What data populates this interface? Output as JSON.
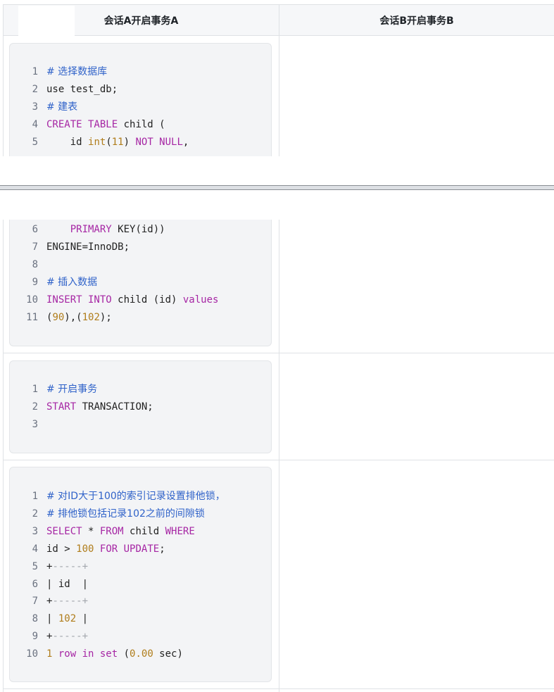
{
  "table": {
    "headers": [
      "会话A开启事务A",
      "会话B开启事务B"
    ]
  },
  "blocks": [
    {
      "lines": [
        {
          "n": "1",
          "parts": [
            {
              "t": "# 选择数据库",
              "c": "c"
            }
          ]
        },
        {
          "n": "2",
          "parts": [
            {
              "t": "use test_db;",
              "c": ""
            }
          ]
        },
        {
          "n": "3",
          "parts": [
            {
              "t": "# 建表",
              "c": "c"
            }
          ]
        },
        {
          "n": "4",
          "parts": [
            {
              "t": "CREATE TABLE",
              "c": "k"
            },
            {
              "t": " child (",
              "c": ""
            }
          ]
        },
        {
          "n": "5",
          "parts": [
            {
              "t": "    id ",
              "c": ""
            },
            {
              "t": "int",
              "c": "n"
            },
            {
              "t": "(",
              "c": ""
            },
            {
              "t": "11",
              "c": "n"
            },
            {
              "t": ") ",
              "c": ""
            },
            {
              "t": "NOT NULL",
              "c": "k"
            },
            {
              "t": ",",
              "c": ""
            }
          ]
        }
      ]
    },
    {
      "lines": [
        {
          "n": "6",
          "parts": [
            {
              "t": "    ",
              "c": ""
            },
            {
              "t": "PRIMARY",
              "c": "k"
            },
            {
              "t": " KEY(id))",
              "c": ""
            }
          ]
        },
        {
          "n": "7",
          "parts": [
            {
              "t": "ENGINE=InnoDB;",
              "c": ""
            }
          ]
        },
        {
          "n": "8",
          "parts": [
            {
              "t": "",
              "c": ""
            }
          ]
        },
        {
          "n": "9",
          "parts": [
            {
              "t": "# 插入数据",
              "c": "c"
            }
          ]
        },
        {
          "n": "10",
          "parts": [
            {
              "t": "INSERT INTO",
              "c": "k"
            },
            {
              "t": " child (id) ",
              "c": ""
            },
            {
              "t": "values",
              "c": "k"
            }
          ]
        },
        {
          "n": "11",
          "parts": [
            {
              "t": "(",
              "c": ""
            },
            {
              "t": "90",
              "c": "n"
            },
            {
              "t": "),(",
              "c": ""
            },
            {
              "t": "102",
              "c": "n"
            },
            {
              "t": ");",
              "c": ""
            }
          ]
        }
      ]
    },
    {
      "lines": [
        {
          "n": "1",
          "parts": [
            {
              "t": "# 开启事务",
              "c": "c"
            }
          ]
        },
        {
          "n": "2",
          "parts": [
            {
              "t": "START",
              "c": "k"
            },
            {
              "t": " TRANSACTION;",
              "c": ""
            }
          ]
        },
        {
          "n": "3",
          "parts": [
            {
              "t": "",
              "c": ""
            }
          ]
        }
      ]
    },
    {
      "lines": [
        {
          "n": "1",
          "parts": [
            {
              "t": "# 对ID大于100的索引记录设置排他锁，",
              "c": "c"
            }
          ]
        },
        {
          "n": "2",
          "parts": [
            {
              "t": "# 排他锁包括记录102之前的间隙锁",
              "c": "c"
            }
          ]
        },
        {
          "n": "3",
          "parts": [
            {
              "t": "SELECT",
              "c": "k"
            },
            {
              "t": " * ",
              "c": ""
            },
            {
              "t": "FROM",
              "c": "k"
            },
            {
              "t": " child ",
              "c": ""
            },
            {
              "t": "WHERE",
              "c": "k"
            }
          ]
        },
        {
          "n": "4",
          "parts": [
            {
              "t": "id > ",
              "c": ""
            },
            {
              "t": "100",
              "c": "n"
            },
            {
              "t": " ",
              "c": ""
            },
            {
              "t": "FOR UPDATE",
              "c": "k"
            },
            {
              "t": ";",
              "c": ""
            }
          ]
        },
        {
          "n": "5",
          "parts": [
            {
              "t": "+",
              "c": ""
            },
            {
              "t": "-----+",
              "c": "d"
            }
          ]
        },
        {
          "n": "6",
          "parts": [
            {
              "t": "| id  |",
              "c": ""
            }
          ]
        },
        {
          "n": "7",
          "parts": [
            {
              "t": "+",
              "c": ""
            },
            {
              "t": "-----+",
              "c": "d"
            }
          ]
        },
        {
          "n": "8",
          "parts": [
            {
              "t": "| ",
              "c": ""
            },
            {
              "t": "102",
              "c": "n"
            },
            {
              "t": " |",
              "c": ""
            }
          ]
        },
        {
          "n": "9",
          "parts": [
            {
              "t": "+",
              "c": ""
            },
            {
              "t": "-----+",
              "c": "d"
            }
          ]
        },
        {
          "n": "10",
          "parts": [
            {
              "t": "1",
              "c": "n"
            },
            {
              "t": " ",
              "c": ""
            },
            {
              "t": "row in set",
              "c": "k"
            },
            {
              "t": " (",
              "c": ""
            },
            {
              "t": "0.00",
              "c": "n"
            },
            {
              "t": " sec)",
              "c": ""
            }
          ]
        }
      ]
    }
  ]
}
